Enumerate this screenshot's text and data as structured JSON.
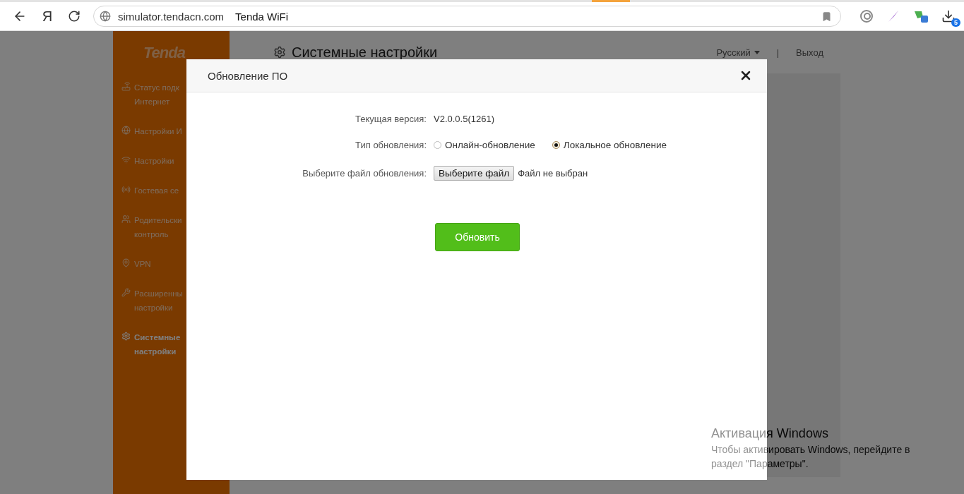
{
  "browser": {
    "logo": "Я",
    "url": "simulator.tendacn.com",
    "page_title": "Tenda WiFi",
    "download_count": "5"
  },
  "sidebar": {
    "logo": "Tenda",
    "items": [
      {
        "kind": "router",
        "lines": [
          "Статус подк",
          "Интернет"
        ],
        "selected": false
      },
      {
        "kind": "globe",
        "lines": [
          "Настройки И"
        ],
        "selected": false
      },
      {
        "kind": "wifi",
        "lines": [
          "Настройки"
        ],
        "selected": false
      },
      {
        "kind": "guest",
        "lines": [
          "Гостевая се"
        ],
        "selected": false
      },
      {
        "kind": "parental",
        "lines": [
          "Родительски",
          "контроль"
        ],
        "selected": false
      },
      {
        "kind": "vpn",
        "lines": [
          "VPN"
        ],
        "selected": false
      },
      {
        "kind": "tools",
        "lines": [
          "Расширенны",
          "настройки"
        ],
        "selected": false
      },
      {
        "kind": "system",
        "lines": [
          "Системные",
          "настройки"
        ],
        "selected": true
      }
    ]
  },
  "header": {
    "title": "Системные настройки",
    "language": "Русский",
    "separator": "|",
    "logout": "Выход"
  },
  "dialog": {
    "title": "Обновление ПО",
    "current_version": {
      "label": "Текущая версия:",
      "value": "V2.0.0.5(1261)"
    },
    "update_type": {
      "label": "Тип обновления:",
      "options": [
        {
          "label": "Онлайн-обновление",
          "selected": false
        },
        {
          "label": "Локальное обновление",
          "selected": true
        }
      ]
    },
    "file": {
      "label": "Выберите файл обновления:",
      "button": "Выберите файл",
      "status": "Файл не выбран"
    },
    "submit": "Обновить"
  },
  "os_notice": {
    "title": "Активация Windows",
    "message": "Чтобы активировать Windows, перейдите в раздел \"Параметры\"."
  }
}
